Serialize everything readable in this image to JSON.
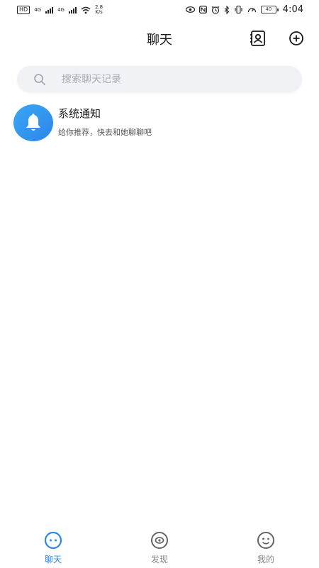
{
  "status_bar": {
    "hd": "HD",
    "network_1": "4G",
    "network_2": "4G",
    "speed_value": "2.8",
    "speed_unit": "K/s",
    "battery": "40",
    "time": "4:04"
  },
  "header": {
    "title": "聊天",
    "contacts_icon": "contacts-icon",
    "add_icon": "add-circle-icon"
  },
  "search": {
    "placeholder": "搜索聊天记录",
    "value": "",
    "icon": "search-icon"
  },
  "conversations": [
    {
      "title": "系统通知",
      "subtitle": "给你推荐，快去和她聊聊吧",
      "avatar_icon": "bell-icon",
      "avatar_color": "#2D86EA"
    }
  ],
  "tabbar": {
    "tabs": [
      {
        "label": "聊天",
        "icon": "chat-icon",
        "active": true
      },
      {
        "label": "发现",
        "icon": "discover-icon",
        "active": false
      },
      {
        "label": "我的",
        "icon": "profile-icon",
        "active": false
      }
    ],
    "active_color": "#2D86EA",
    "inactive_color": "#888888"
  }
}
